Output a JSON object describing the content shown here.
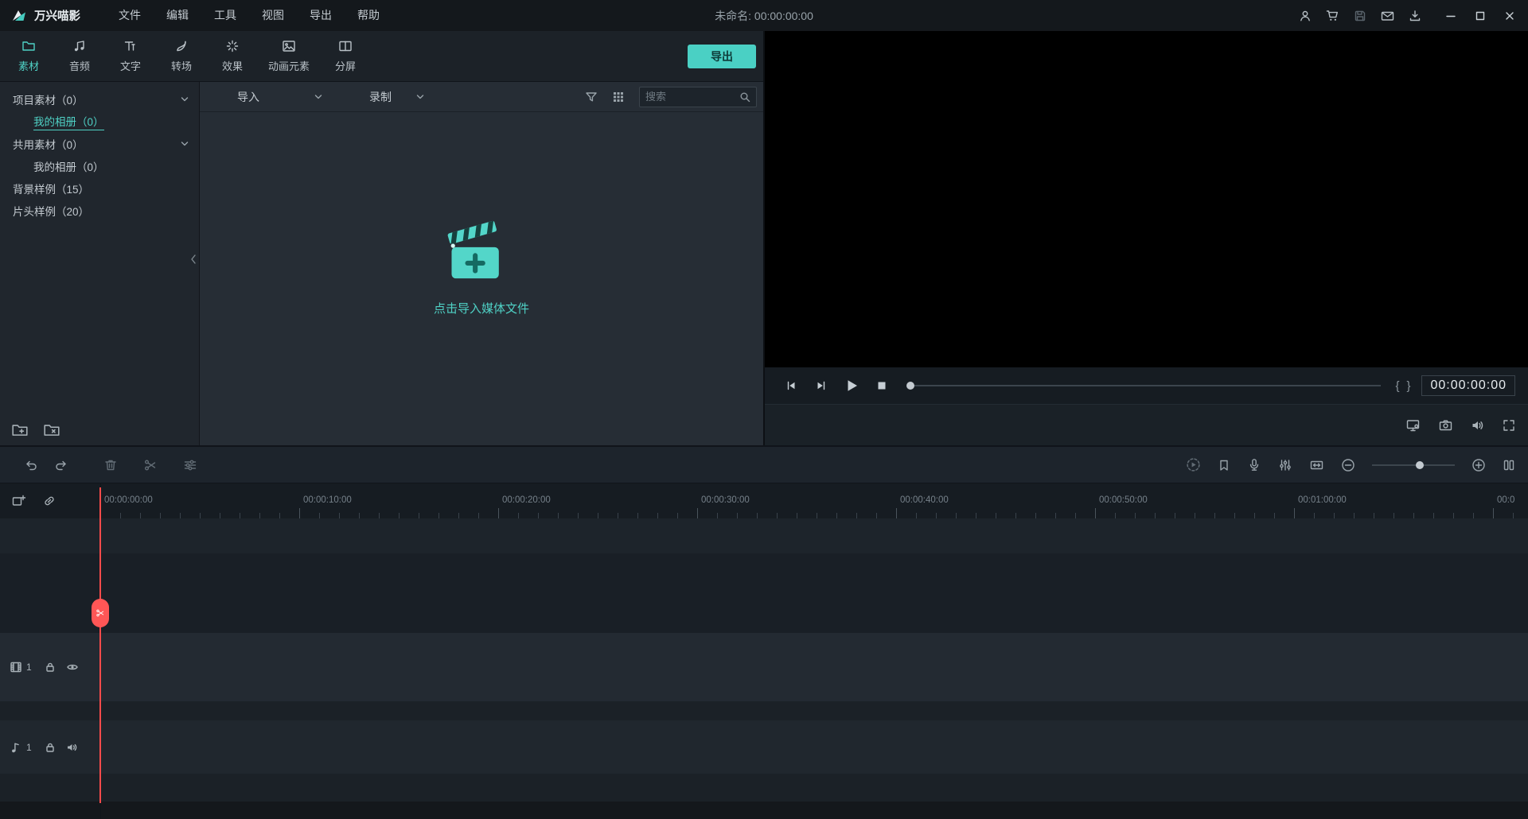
{
  "colors": {
    "accent": "#4FD1C5",
    "playhead": "#FF4B4B",
    "export_button": "#4AD0C4"
  },
  "titlebar": {
    "app_name": "万兴喵影",
    "menus": [
      "文件",
      "编辑",
      "工具",
      "视图",
      "导出",
      "帮助"
    ],
    "project_title": "未命名: 00:00:00:00",
    "icons": [
      "user-icon",
      "cart-icon",
      "save-icon",
      "mail-icon",
      "download-icon",
      "minimize-icon",
      "maximize-icon",
      "close-icon"
    ]
  },
  "tabs": {
    "items": [
      {
        "label": "素材",
        "icon": "folder-icon",
        "active": true
      },
      {
        "label": "音频",
        "icon": "music-icon",
        "active": false
      },
      {
        "label": "文字",
        "icon": "text-icon",
        "active": false
      },
      {
        "label": "转场",
        "icon": "transition-icon",
        "active": false
      },
      {
        "label": "效果",
        "icon": "effects-icon",
        "active": false
      },
      {
        "label": "动画元素",
        "icon": "elements-icon",
        "active": false
      },
      {
        "label": "分屏",
        "icon": "split-screen-icon",
        "active": false
      }
    ],
    "export_button": "导出"
  },
  "sidebar": {
    "items": [
      {
        "label": "项目素材（0）",
        "indent": 0,
        "chevron": true,
        "selected": false
      },
      {
        "label": "我的相册（0）",
        "indent": 1,
        "chevron": false,
        "selected": true
      },
      {
        "label": "共用素材（0）",
        "indent": 0,
        "chevron": true,
        "selected": false
      },
      {
        "label": "我的相册（0）",
        "indent": 1,
        "chevron": false,
        "selected": false
      },
      {
        "label": "背景样例（15）",
        "indent": 0,
        "chevron": false,
        "selected": false
      },
      {
        "label": "片头样例（20）",
        "indent": 0,
        "chevron": false,
        "selected": false
      }
    ],
    "footer_icons": [
      "folder-add-icon",
      "folder-delete-icon"
    ]
  },
  "media": {
    "import_label": "导入",
    "record_label": "录制",
    "search_placeholder": "搜索",
    "empty_prompt": "点击导入媒体文件",
    "toolbar_icons": [
      "filter-icon",
      "grid-view-icon",
      "search-icon"
    ]
  },
  "preview": {
    "timecode": "00:00:00:00",
    "mark_in": "{",
    "mark_out": "}",
    "controls": [
      "previous-frame-icon",
      "next-frame-icon",
      "play-icon",
      "stop-icon"
    ],
    "footer_icons": [
      "display-settings-icon",
      "snapshot-icon",
      "volume-icon",
      "fullscreen-icon"
    ]
  },
  "toolbar": {
    "left_icons": [
      "undo-icon",
      "redo-icon",
      "delete-icon",
      "split-scissors-icon",
      "properties-icon"
    ],
    "right_icons": [
      "render-preview-icon",
      "marker-icon",
      "voiceover-mic-icon",
      "audio-mixer-icon",
      "fit-timeline-icon",
      "zoom-out-icon",
      "zoom-slider",
      "zoom-in-icon",
      "track-height-icon"
    ]
  },
  "timeline": {
    "ruler_labels": [
      "00:00:00:00",
      "00:00:10:00",
      "00:00:20:00",
      "00:00:30:00",
      "00:00:40:00",
      "00:00:50:00",
      "00:01:00:00",
      "00:0"
    ],
    "corner_icons": [
      "add-to-track-icon",
      "link-icon"
    ],
    "video_track_number": "1",
    "audio_track_number": "1"
  }
}
